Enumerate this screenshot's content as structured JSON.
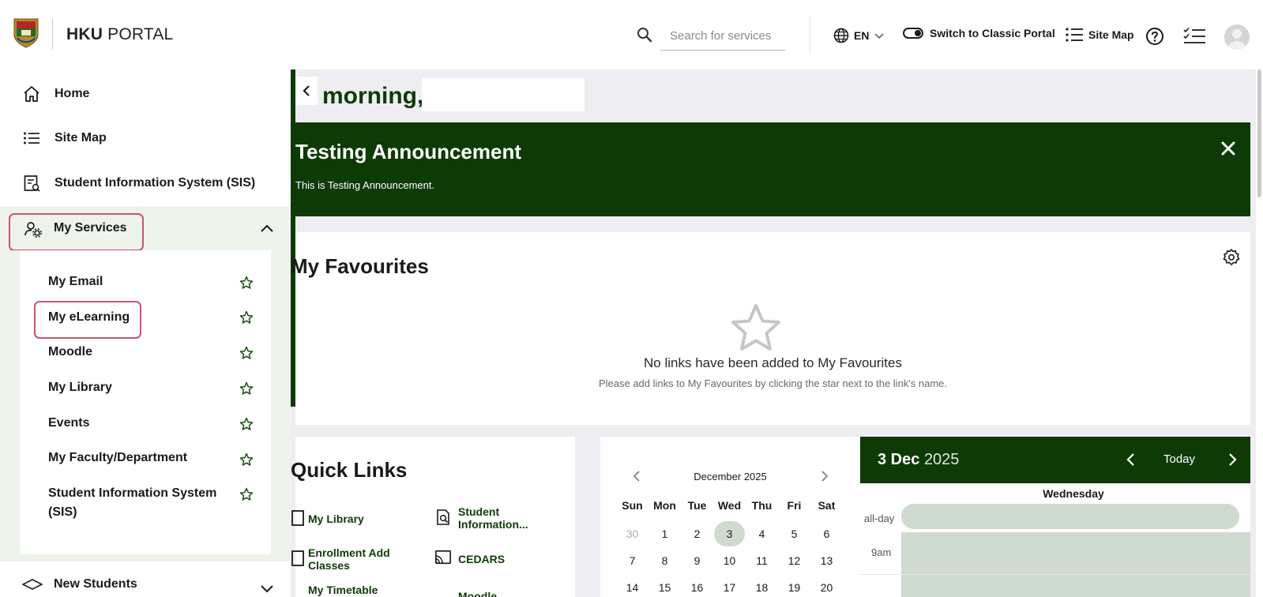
{
  "header": {
    "brand_bold": "HKU",
    "brand_light": "PORTAL",
    "search_placeholder": "Search for services",
    "language": "EN",
    "classic_label": "Switch to Classic Portal",
    "sitemap_label": "Site Map"
  },
  "sidebar": {
    "items": [
      {
        "label": "Home",
        "icon": "home-icon"
      },
      {
        "label": "Site Map",
        "icon": "list-icon"
      },
      {
        "label": "Student Information System (SIS)",
        "icon": "document-icon"
      }
    ],
    "services_label": "My Services",
    "services_icon": "user-gear-icon",
    "submenu": [
      {
        "label": "My Email"
      },
      {
        "label": "My eLearning"
      },
      {
        "label": "Moodle"
      },
      {
        "label": "My Library"
      },
      {
        "label": "Events"
      },
      {
        "label": "My Faculty/Department"
      },
      {
        "label": "Student Information System (SIS)"
      }
    ],
    "new_students_label": "New Students"
  },
  "main": {
    "greeting": "morning,",
    "announcement": {
      "title": "Testing Announcement",
      "body": "This is Testing Announcement."
    },
    "favourites": {
      "title": "My Favourites",
      "empty_title": "No links have been added to My Favourites",
      "empty_hint": "Please add links to My Favourites by clicking the star next to the link's name."
    },
    "quick_links": {
      "title": "Quick Links",
      "links": [
        {
          "label": "My Library"
        },
        {
          "label": "Student Information..."
        },
        {
          "label": "Enrollment Add Classes"
        },
        {
          "label": "CEDARS"
        },
        {
          "label": "My Timetable"
        },
        {
          "label": "Moodle"
        }
      ]
    },
    "calendar": {
      "month": "December 2025",
      "weekdays": [
        "Sun",
        "Mon",
        "Tue",
        "Wed",
        "Thu",
        "Fri",
        "Sat"
      ],
      "weeks": [
        [
          "30",
          "1",
          "2",
          "3",
          "4",
          "5",
          "6"
        ],
        [
          "7",
          "8",
          "9",
          "10",
          "11",
          "12",
          "13"
        ],
        [
          "14",
          "15",
          "16",
          "17",
          "18",
          "19",
          "20"
        ]
      ],
      "selected": "3"
    },
    "day_view": {
      "day": "3 Dec",
      "year": "2025",
      "today_label": "Today",
      "weekday": "Wednesday",
      "allday_label": "all-day",
      "first_slot_label": "9am"
    }
  },
  "colors": {
    "primary": "#0e3a06",
    "highlight_border": "#c8566c",
    "calendar_fill": "#d0dbd0"
  }
}
